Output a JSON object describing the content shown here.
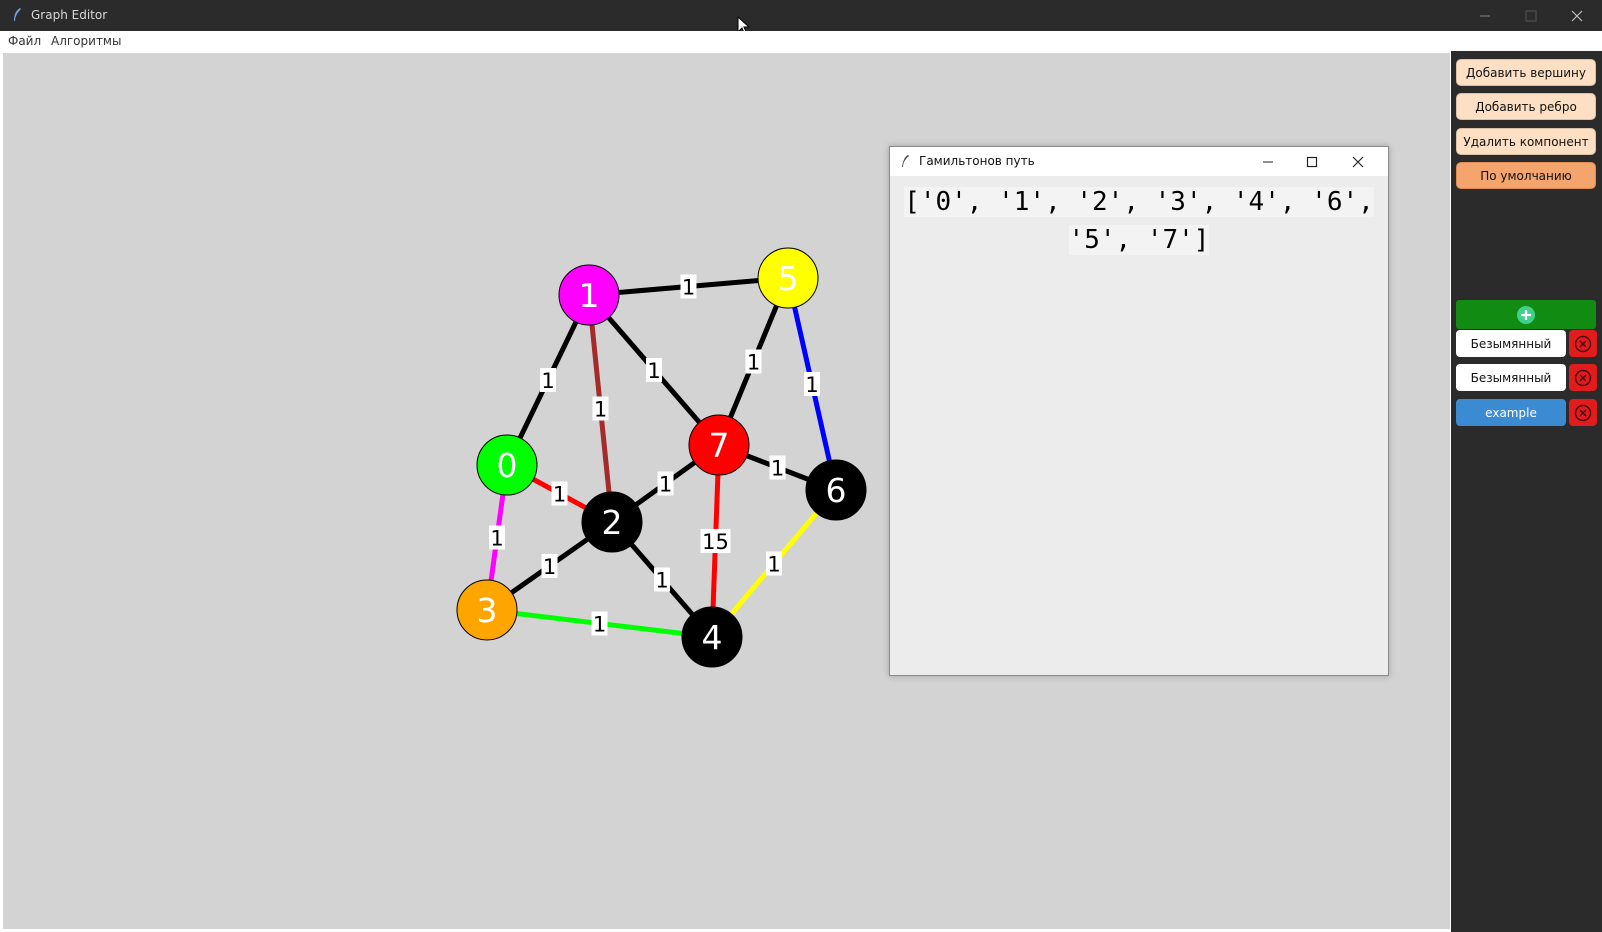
{
  "window": {
    "title": "Graph Editor",
    "icon": "feather-icon"
  },
  "menu": {
    "items": [
      "Файл",
      "Алгоритмы"
    ]
  },
  "panel": {
    "buttons": {
      "add_vertex": "Добавить вершину",
      "add_edge": "Добавить ребро",
      "delete_component": "Удалить компонент",
      "default": "По умолчанию"
    },
    "add_graph_icon": "plus-circle-icon",
    "graphs": [
      {
        "name": "Безымянный",
        "active": false
      },
      {
        "name": "Безымянный",
        "active": false
      },
      {
        "name": "example",
        "active": true
      }
    ],
    "delete_icon": "close-circle-icon"
  },
  "dialog": {
    "title": "Гамильтонов путь",
    "result": "['0', '1', '2', '3', '4', '6', '5', '7']"
  },
  "graph": {
    "nodes": [
      {
        "id": "0",
        "color": "#00ff00"
      },
      {
        "id": "1",
        "color": "#ff00ff"
      },
      {
        "id": "2",
        "color": "#000000"
      },
      {
        "id": "3",
        "color": "#ffa500"
      },
      {
        "id": "4",
        "color": "#000000"
      },
      {
        "id": "5",
        "color": "#ffff00"
      },
      {
        "id": "6",
        "color": "#000000"
      },
      {
        "id": "7",
        "color": "#ff0000"
      }
    ],
    "edges": [
      {
        "from": "1",
        "to": "5",
        "weight": "1",
        "color": "#000000"
      },
      {
        "from": "1",
        "to": "0",
        "weight": "1",
        "color": "#000000"
      },
      {
        "from": "1",
        "to": "2",
        "weight": "1",
        "color": "#a52a2a"
      },
      {
        "from": "1",
        "to": "7",
        "weight": "1",
        "color": "#000000"
      },
      {
        "from": "5",
        "to": "7",
        "weight": "1",
        "color": "#000000"
      },
      {
        "from": "5",
        "to": "6",
        "weight": "1",
        "color": "#0000ff"
      },
      {
        "from": "0",
        "to": "2",
        "weight": "1",
        "color": "#ff0000"
      },
      {
        "from": "0",
        "to": "3",
        "weight": "1",
        "color": "#ff00ff"
      },
      {
        "from": "2",
        "to": "7",
        "weight": "1",
        "color": "#000000"
      },
      {
        "from": "7",
        "to": "6",
        "weight": "1",
        "color": "#000000"
      },
      {
        "from": "7",
        "to": "4",
        "weight": "15",
        "color": "#ff0000"
      },
      {
        "from": "2",
        "to": "3",
        "weight": "1",
        "color": "#000000"
      },
      {
        "from": "2",
        "to": "4",
        "weight": "1",
        "color": "#000000"
      },
      {
        "from": "6",
        "to": "4",
        "weight": "1",
        "color": "#ffff00"
      },
      {
        "from": "3",
        "to": "4",
        "weight": "1",
        "color": "#00ff00"
      }
    ]
  }
}
